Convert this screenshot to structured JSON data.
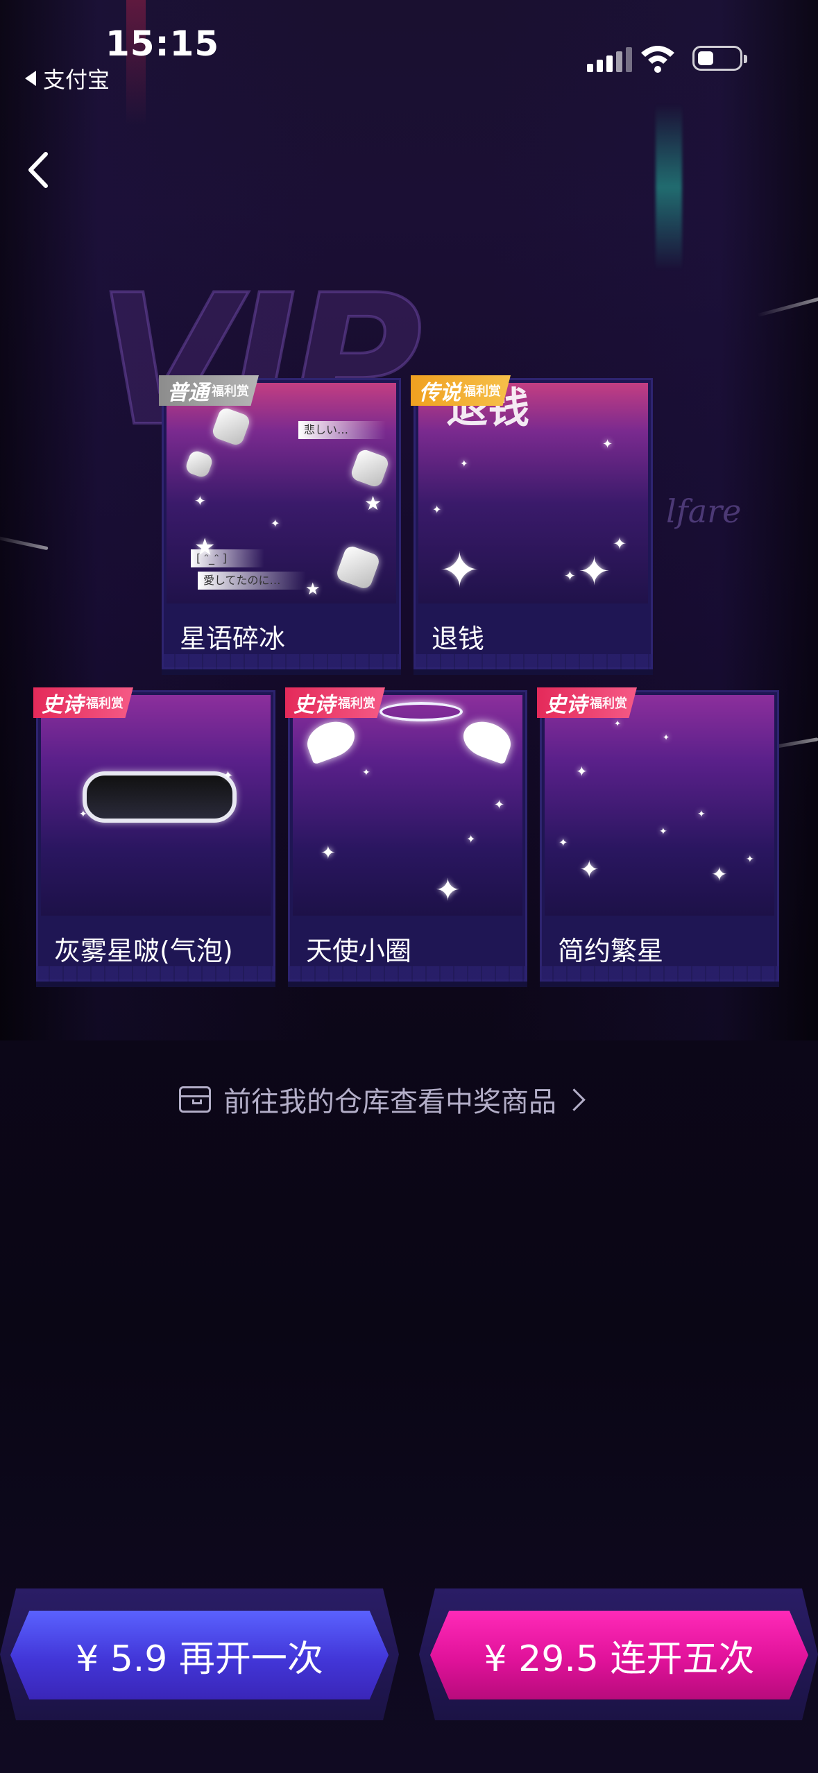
{
  "status_bar": {
    "time": "15:15",
    "back_app": "支付宝"
  },
  "nav": {
    "back_icon": "chevron-left-icon"
  },
  "background": {
    "logo_text": "VIP",
    "welfare_text": "lfare"
  },
  "prizes": [
    {
      "rarity": "普通",
      "badge_sub": "福利赏",
      "name": "星语碎冰",
      "badge_color": "#9e9e9e"
    },
    {
      "rarity": "传说",
      "badge_sub": "福利赏",
      "name": "退钱",
      "badge_color": "#f0a020"
    },
    {
      "rarity": "史诗",
      "badge_sub": "福利赏",
      "name": "灰雾星啵(气泡)",
      "badge_color": "#e42a5a"
    },
    {
      "rarity": "史诗",
      "badge_sub": "福利赏",
      "name": "天使小圈",
      "badge_color": "#e42a5a"
    },
    {
      "rarity": "史诗",
      "badge_sub": "福利赏",
      "name": "简约繁星",
      "badge_color": "#e42a5a"
    }
  ],
  "card_decor": {
    "ice_tags": [
      "悲しい…",
      "愛してたのに…",
      "[ ᵔ_ᵔ ]"
    ],
    "tuiqian_title": "退钱"
  },
  "warehouse_link": {
    "icon": "box-icon",
    "text": "前往我的仓库查看中奖商品"
  },
  "buttons": {
    "again": "¥ 5.9 再开一次",
    "five": "¥ 29.5 连开五次"
  }
}
